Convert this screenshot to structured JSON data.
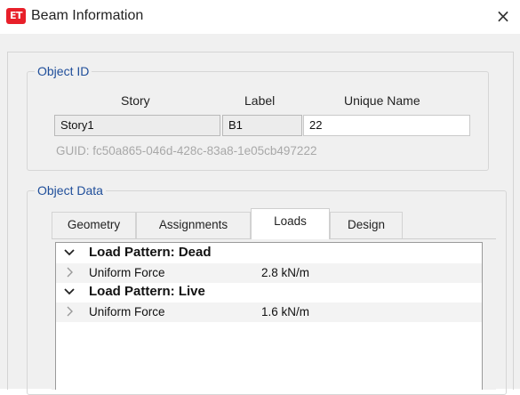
{
  "window": {
    "app_icon_text": "ET",
    "title": "Beam Information",
    "close_glyph": "×"
  },
  "object_id": {
    "legend": "Object ID",
    "columns": {
      "story": "Story",
      "label": "Label",
      "unique_name": "Unique Name"
    },
    "values": {
      "story": "Story1",
      "label": "B1",
      "unique_name": "22"
    },
    "guid": "GUID: fc50a865-046d-428c-83a8-1e05cb497222"
  },
  "object_data": {
    "legend": "Object Data",
    "tabs": [
      {
        "label": "Geometry",
        "active": false
      },
      {
        "label": "Assignments",
        "active": false
      },
      {
        "label": "Loads",
        "active": true
      },
      {
        "label": "Design",
        "active": false
      }
    ],
    "loads_tree": [
      {
        "group": "Load Pattern: Dead",
        "expanded": true,
        "items": [
          {
            "label": "Uniform Force",
            "value": "2.8 kN/m"
          }
        ]
      },
      {
        "group": "Load Pattern: Live",
        "expanded": true,
        "items": [
          {
            "label": "Uniform Force",
            "value": "1.6 kN/m"
          }
        ]
      }
    ]
  },
  "colors": {
    "accent_text": "#1f4e9a",
    "app_icon": "#e8202a",
    "dialog_bg": "#f0f0f0"
  },
  "icons": {
    "app": "etabs-app-icon",
    "close": "close-icon",
    "expanded": "chevron-down-icon",
    "collapsed": "chevron-right-icon"
  }
}
